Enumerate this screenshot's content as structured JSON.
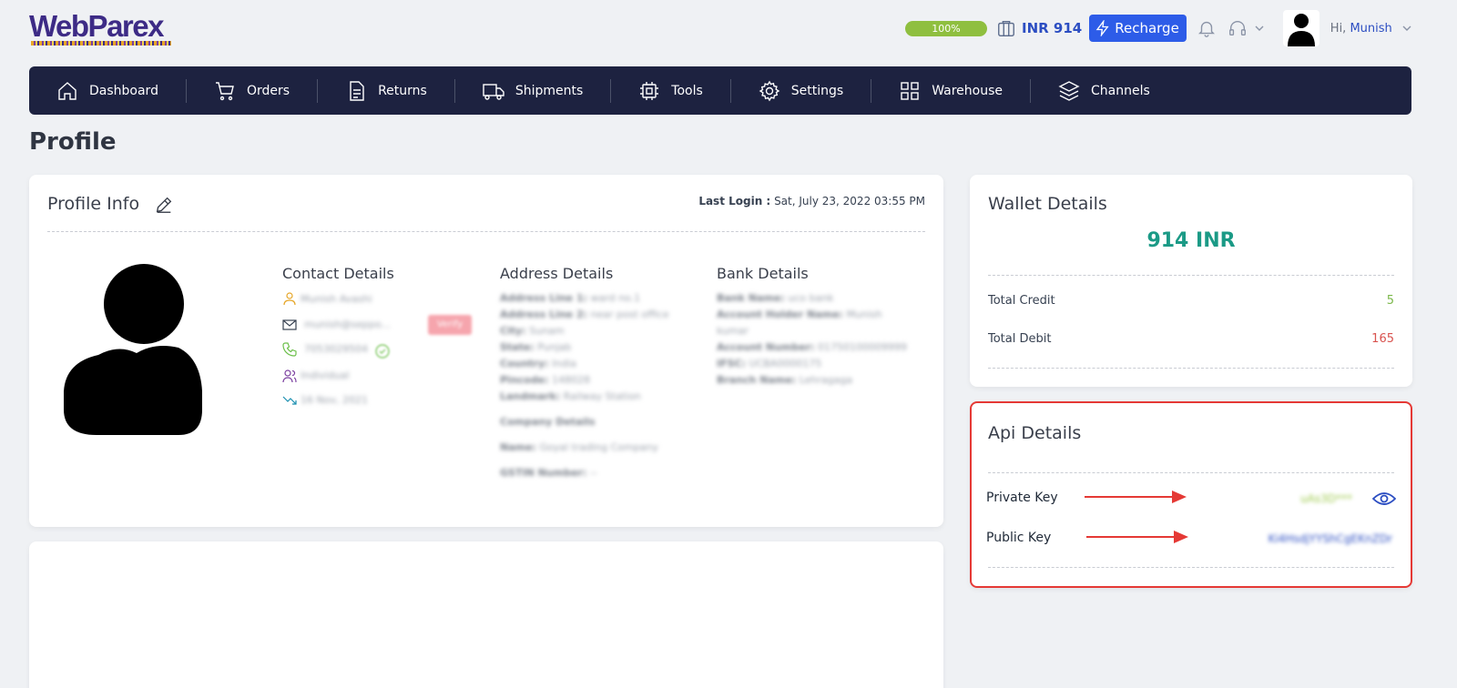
{
  "brand": {
    "logo_text": "WebParex"
  },
  "header": {
    "progress_label": "100%",
    "progress_value": 1.0,
    "balance_label": "INR 914",
    "recharge_label": "Recharge",
    "greeting_prefix": "Hi,",
    "user_name": "Munish"
  },
  "nav": {
    "items": [
      {
        "label": "Dashboard",
        "icon": "home-icon"
      },
      {
        "label": "Orders",
        "icon": "cart-icon"
      },
      {
        "label": "Returns",
        "icon": "document-icon"
      },
      {
        "label": "Shipments",
        "icon": "truck-icon"
      },
      {
        "label": "Tools",
        "icon": "chip-icon"
      },
      {
        "label": "Settings",
        "icon": "gear-icon"
      },
      {
        "label": "Warehouse",
        "icon": "grid-icon"
      },
      {
        "label": "Channels",
        "icon": "layers-icon"
      }
    ]
  },
  "page": {
    "title": "Profile"
  },
  "profile_info": {
    "title": "Profile Info",
    "last_login_label": "Last Login :",
    "last_login_value": "Sat, July 23, 2022 03:55 PM",
    "contact": {
      "title": "Contact Details",
      "name": "Munish Avashi",
      "email": "munish@seppo...",
      "verify_badge": "Verify",
      "phone": "7053029504",
      "type": "Individual",
      "joined": "16 Nov, 2021"
    },
    "address": {
      "title": "Address Details",
      "lines": [
        {
          "k": "Address Line 1:",
          "v": "ward no.1"
        },
        {
          "k": "Address Line 2:",
          "v": "near post office"
        },
        {
          "k": "City:",
          "v": "Sunam"
        },
        {
          "k": "State:",
          "v": "Punjab"
        },
        {
          "k": "Country:",
          "v": "India"
        },
        {
          "k": "Pincode:",
          "v": "148028"
        },
        {
          "k": "Landmark:",
          "v": "Railway Station"
        }
      ],
      "company_title": "Company Details",
      "company_name_k": "Name:",
      "company_name_v": "Goyal trading Company",
      "gstin_k": "GSTIN Number:",
      "gstin_v": "--"
    },
    "bank": {
      "title": "Bank Details",
      "lines": [
        {
          "k": "Bank Name:",
          "v": "uco bank"
        },
        {
          "k": "Account Holder Name:",
          "v": "Munish"
        },
        {
          "k": "",
          "v": "kumar"
        },
        {
          "k": "Account Number:",
          "v": "01750100009999"
        },
        {
          "k": "IFSC:",
          "v": "UCBA0000175"
        },
        {
          "k": "Branch Name:",
          "v": "Lehragaga"
        }
      ]
    }
  },
  "wallet": {
    "title": "Wallet Details",
    "amount": "914 INR",
    "credit_label": "Total Credit",
    "credit_value": "5",
    "debit_label": "Total Debit",
    "debit_value": "165"
  },
  "api": {
    "title": "Api Details",
    "private_key_label": "Private Key",
    "private_key_value": "uAs3D***",
    "public_key_label": "Public Key",
    "public_key_value": "Ki4HsdjYYShCgEKnZDr"
  },
  "colors": {
    "nav_bg": "#1d2240",
    "accent_blue": "#2d5ce8",
    "wallet_amount": "#1b9a86",
    "credit": "#7bb84a",
    "debit": "#d9534f",
    "highlight_red": "#e53935"
  }
}
